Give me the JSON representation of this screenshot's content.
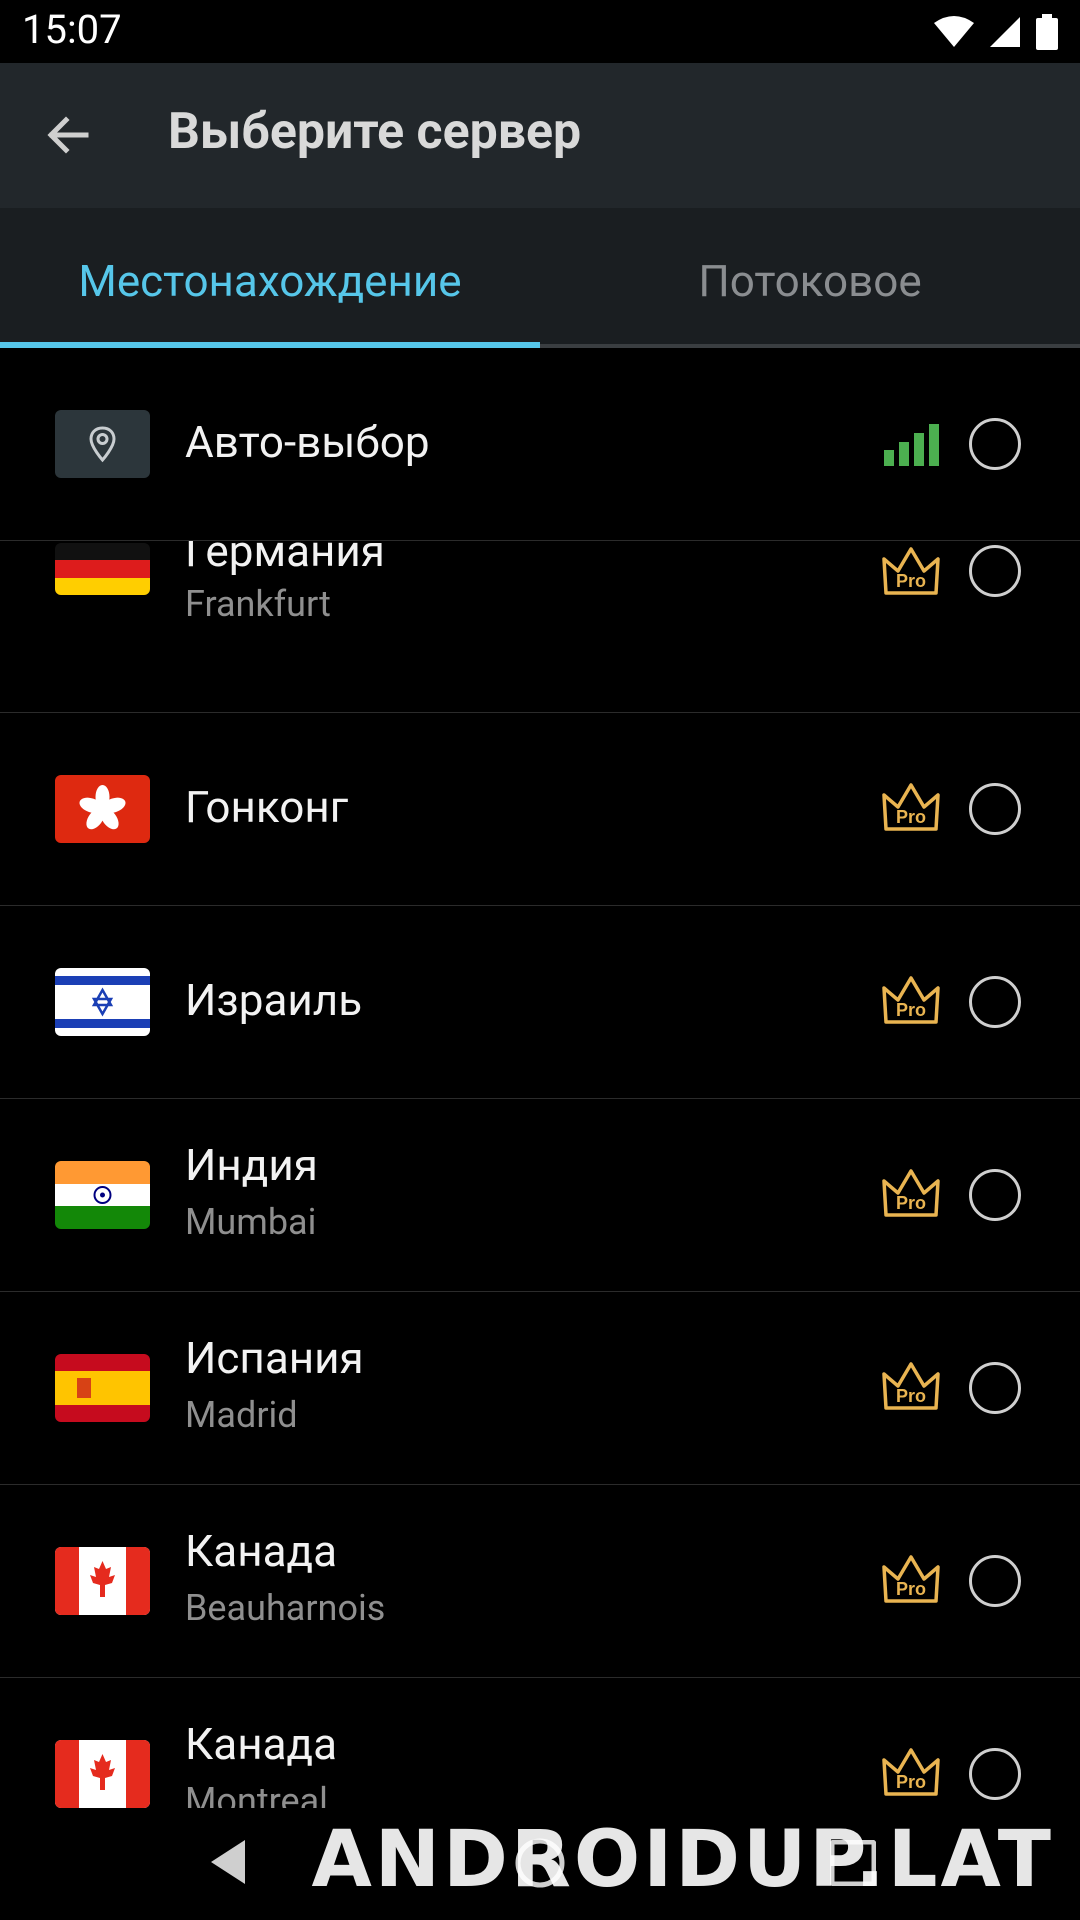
{
  "status_bar": {
    "time": "15:07"
  },
  "app_bar": {
    "title": "Выберите сервер"
  },
  "tabs": [
    {
      "label": "Местонахождение",
      "active": true
    },
    {
      "label": "Потоковое",
      "active": false
    }
  ],
  "servers": [
    {
      "title": "Авто-выбор",
      "subtitle": "",
      "icon": "location-pin-icon",
      "badge": "signal",
      "selected": false
    },
    {
      "title": "Германия",
      "subtitle": "Frankfurt",
      "icon": "flag-germany",
      "badge": "pro",
      "selected": false
    },
    {
      "title": "Гонконг",
      "subtitle": "",
      "icon": "flag-hong-kong",
      "badge": "pro",
      "selected": false
    },
    {
      "title": "Израиль",
      "subtitle": "",
      "icon": "flag-israel",
      "badge": "pro",
      "selected": false
    },
    {
      "title": "Индия",
      "subtitle": "Mumbai",
      "icon": "flag-india",
      "badge": "pro",
      "selected": false
    },
    {
      "title": "Испания",
      "subtitle": "Madrid",
      "icon": "flag-spain",
      "badge": "pro",
      "selected": false
    },
    {
      "title": "Канада",
      "subtitle": "Beauharnois",
      "icon": "flag-canada",
      "badge": "pro",
      "selected": false
    },
    {
      "title": "Канада",
      "subtitle": "Montreal",
      "icon": "flag-canada",
      "badge": "pro",
      "selected": false
    }
  ],
  "pro_badge_label": "Pro",
  "watermark": "ANDROIDUP.LAT",
  "colors": {
    "accent": "#56c6e9",
    "pro": "#e9b451",
    "signal": "#4caf50",
    "app_bar": "#22272b"
  }
}
